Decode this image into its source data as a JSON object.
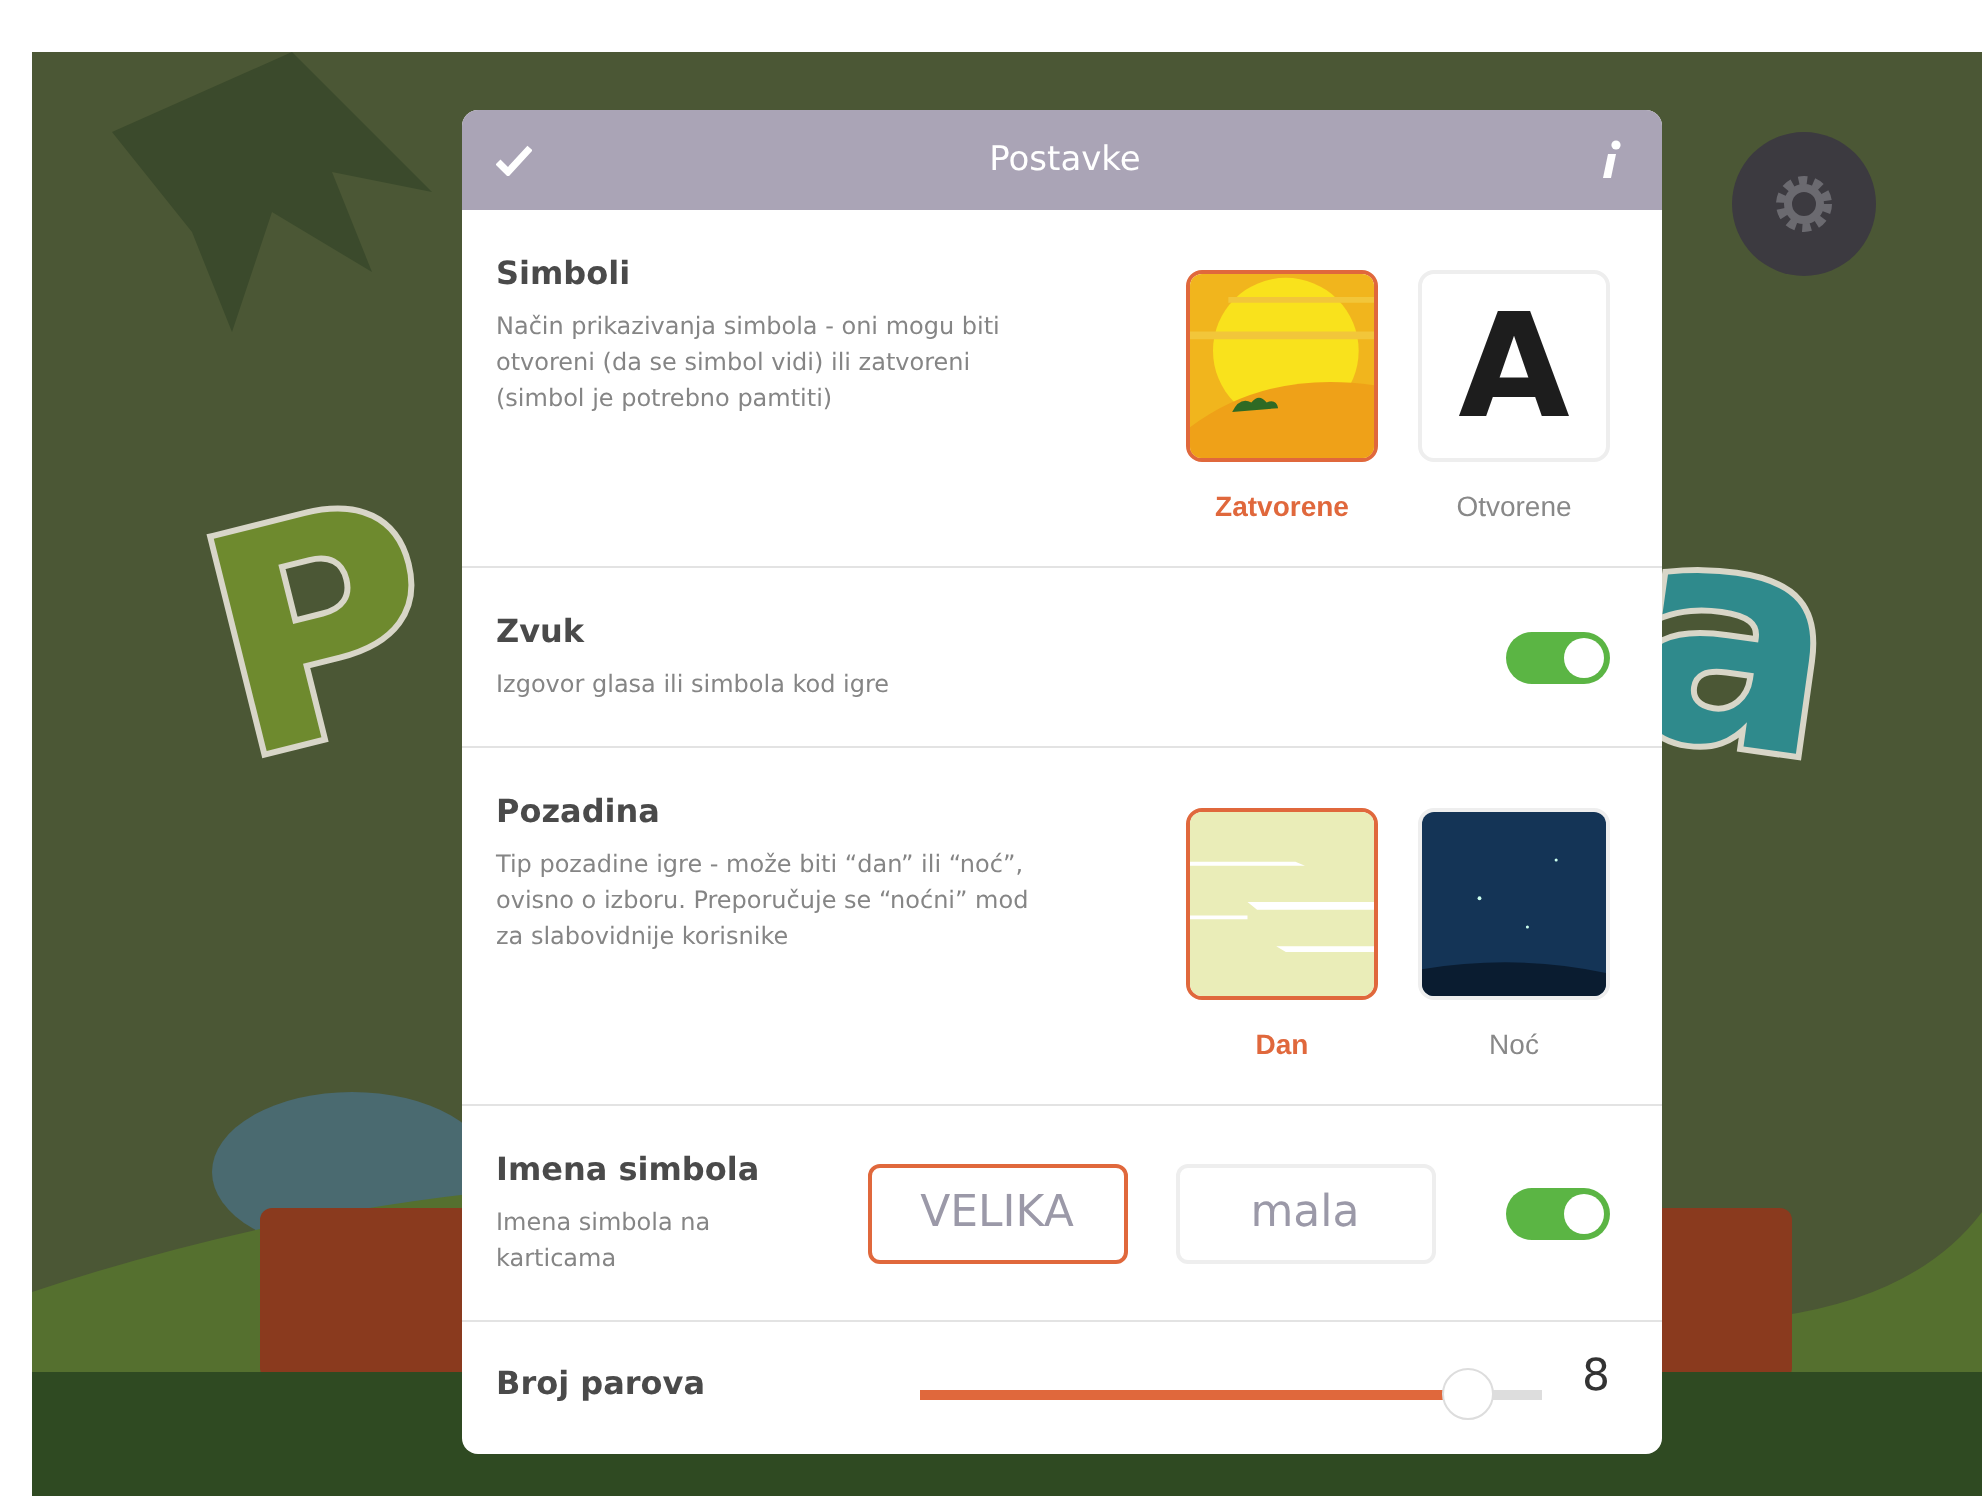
{
  "background": {
    "logo_left": "P",
    "logo_right": "a"
  },
  "header": {
    "title": "Postavke"
  },
  "sections": [
    {
      "kind": "image_choice",
      "title": "Simboli",
      "description": "Način prikazivanja simbola - oni mogu biti otvoreni (da se simbol vidi) ili zatvoreni (simbol je potrebno pamtiti)",
      "options": [
        {
          "kind": "sun",
          "label": "Zatvorene",
          "selected": true
        },
        {
          "kind": "letter",
          "glyph": "A",
          "label": "Otvorene",
          "selected": false
        }
      ]
    },
    {
      "kind": "toggle",
      "title": "Zvuk",
      "description": "Izgovor glasa ili simbola kod igre",
      "on": true
    },
    {
      "kind": "image_choice",
      "title": "Pozadina",
      "description": "Tip pozadine igre - može biti “dan” ili “noć”, ovisno o izboru. Preporučuje se “noćni” mod za slabovidnije korisnike",
      "options": [
        {
          "kind": "day",
          "label": "Dan",
          "selected": true
        },
        {
          "kind": "night",
          "label": "Noć",
          "selected": false
        }
      ]
    },
    {
      "kind": "text_choice_toggle",
      "title": "Imena simbola",
      "description": "Imena simbola na karticama",
      "options": [
        {
          "label": "VELIKA",
          "selected": true
        },
        {
          "label": "mala",
          "selected": false
        }
      ],
      "on": true
    },
    {
      "kind": "slider",
      "title": "Broj parova",
      "level": 0.88,
      "value": "8"
    }
  ]
}
